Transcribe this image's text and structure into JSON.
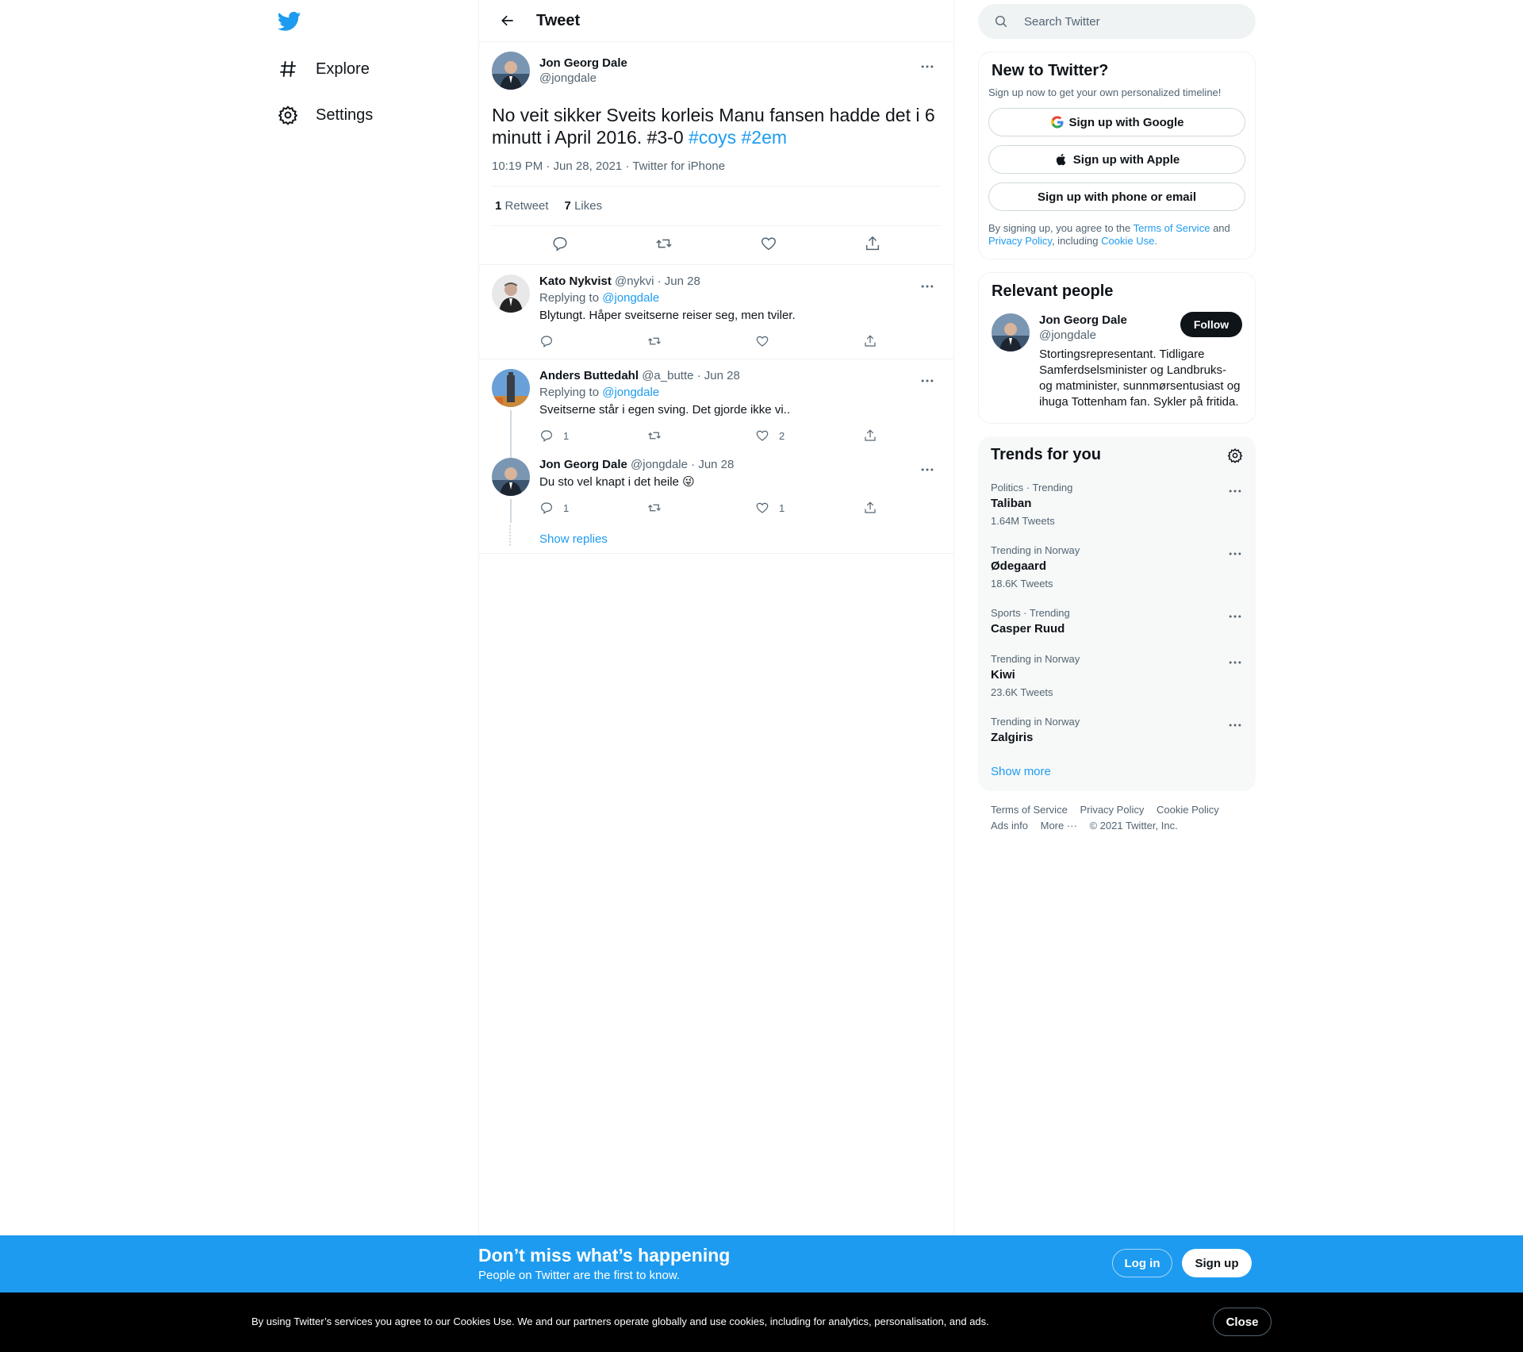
{
  "nav": {
    "items": [
      {
        "label": "Explore",
        "icon": "hashtag-icon"
      },
      {
        "label": "Settings",
        "icon": "gear-icon"
      }
    ]
  },
  "header": {
    "title": "Tweet"
  },
  "tweet": {
    "author_name": "Jon Georg Dale",
    "author_handle": "@jongdale",
    "text": "No veit sikker Sveits korleis Manu fansen hadde det i 6 minutt i April 2016. #3-0",
    "hashtag1": "#coys",
    "hashtag2": "#2em",
    "time": "10:19 PM · Jun 28, 2021 · Twitter for iPhone",
    "retweets_count": "1",
    "retweets_label": "Retweet",
    "likes_count": "7",
    "likes_label": "Likes"
  },
  "replies": [
    {
      "name": "Kato Nykvist",
      "handle": "@nykvi",
      "date": "· Jun 28",
      "replying_to_label": "Replying to",
      "replying_to": "@jongdale",
      "text": "Blytungt. Håper sveitserne reiser seg, men tviler.",
      "reply_count": "",
      "like_count": ""
    },
    {
      "name": "Anders Buttedahl",
      "handle": "@a_butte",
      "date": "· Jun 28",
      "replying_to_label": "Replying to",
      "replying_to": "@jongdale",
      "text": "Sveitserne står i egen sving. Det gjorde ikke vi..",
      "reply_count": "1",
      "like_count": "2"
    },
    {
      "name": "Jon Georg Dale",
      "handle": "@jongdale",
      "date": "· Jun 28",
      "text": "Du sto vel knapt i det heile 😜",
      "reply_count": "1",
      "like_count": "1"
    }
  ],
  "show_replies": "Show replies",
  "search": {
    "placeholder": "Search Twitter"
  },
  "signup_card": {
    "title": "New to Twitter?",
    "subtitle": "Sign up now to get your own personalized timeline!",
    "google": "Sign up with Google",
    "apple": "Sign up with Apple",
    "phone": "Sign up with phone or email",
    "legal_prefix": "By signing up, you agree to the",
    "terms": "Terms of Service",
    "and": "and",
    "privacy": "Privacy Policy",
    "including": ", including",
    "cookie": "Cookie Use."
  },
  "relevant": {
    "title": "Relevant people",
    "name": "Jon Georg Dale",
    "handle": "@jongdale",
    "bio": "Stortingsrepresentant. Tidligare Samferdselsminister og Landbruks- og matminister, sunnmørsentusiast og ihuga Tottenham fan. Sykler på fritida.",
    "follow": "Follow"
  },
  "trends": {
    "title": "Trends for you",
    "items": [
      {
        "meta": "Politics · Trending",
        "name": "Taliban",
        "count": "1.64M Tweets"
      },
      {
        "meta": "Trending in Norway",
        "name": "Ødegaard",
        "count": "18.6K Tweets"
      },
      {
        "meta": "Sports · Trending",
        "name": "Casper Ruud",
        "count": ""
      },
      {
        "meta": "Trending in Norway",
        "name": "Kiwi",
        "count": "23.6K Tweets"
      },
      {
        "meta": "Trending in Norway",
        "name": "Zalgiris",
        "count": ""
      }
    ],
    "show_more": "Show more"
  },
  "footer": {
    "terms": "Terms of Service",
    "privacy": "Privacy Policy",
    "cookie": "Cookie Policy",
    "ads": "Ads info",
    "more": "More ···",
    "copyright": "© 2021 Twitter, Inc."
  },
  "banner": {
    "title": "Don’t miss what’s happening",
    "subtitle": "People on Twitter are the first to know.",
    "login": "Log in",
    "signup": "Sign up"
  },
  "cookie_bar": {
    "text": "By using Twitter’s services you agree to our Cookies Use. We and our partners operate globally and use cookies, including for analytics, personalisation, and ads.",
    "close": "Close"
  },
  "colors": {
    "accent": "#1d9bf0",
    "text": "#0f1419",
    "muted": "#536471"
  }
}
